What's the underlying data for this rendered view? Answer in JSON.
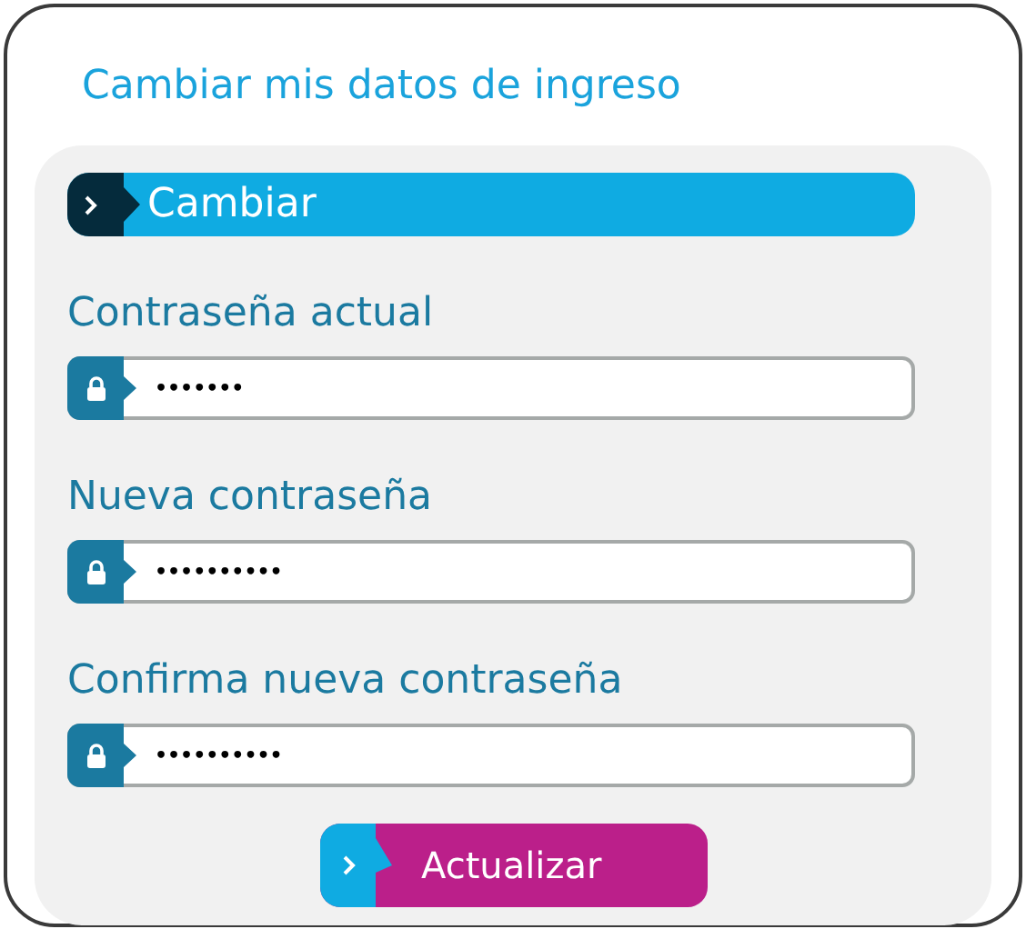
{
  "title": "Cambiar mis datos de ingreso",
  "section": {
    "label": "Cambiar"
  },
  "fields": [
    {
      "label": "Contraseña actual",
      "value": "•••••••"
    },
    {
      "label": "Nueva contraseña",
      "value": "••••••••••"
    },
    {
      "label": "Confirma nueva contraseña",
      "value": "••••••••••"
    }
  ],
  "submit": {
    "label": "Actualizar"
  }
}
